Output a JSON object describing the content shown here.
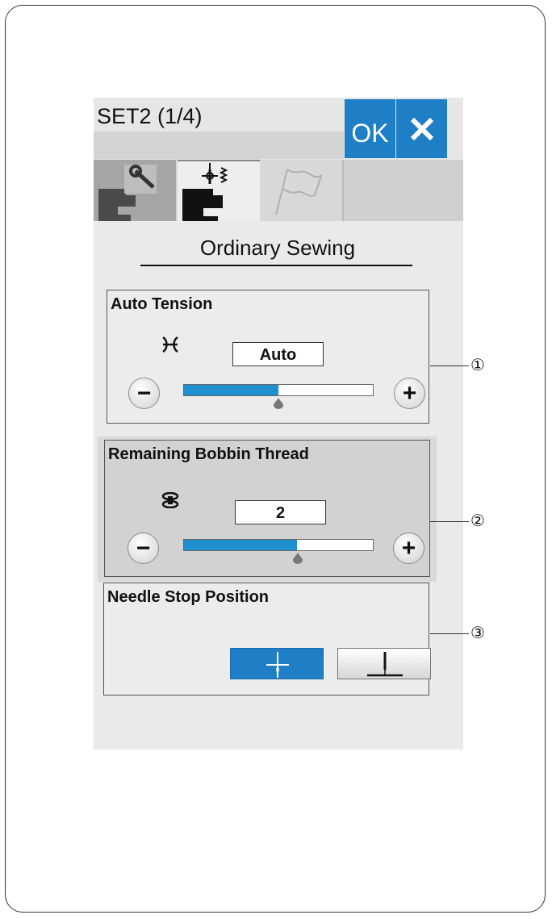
{
  "header": {
    "title": "SET2 (1/4)",
    "ok_label": "OK",
    "close_label": "✕"
  },
  "tabs": [
    {
      "name": "machine-settings",
      "icon": "wrench-machine-icon",
      "selected": false
    },
    {
      "name": "ordinary-sewing",
      "icon": "machine-stitch-icon",
      "selected": true
    },
    {
      "name": "language",
      "icon": "flag-icon",
      "selected": false
    }
  ],
  "section": {
    "title": "Ordinary Sewing"
  },
  "auto_tension": {
    "label": "Auto Tension",
    "icon": "tension-icon",
    "value": "Auto",
    "minus": "−",
    "plus": "+",
    "level_fraction": 0.5
  },
  "bobbin": {
    "label": "Remaining Bobbin Thread",
    "icon": "bobbin-icon",
    "value": "2",
    "minus": "−",
    "plus": "+",
    "level_fraction": 0.6
  },
  "needle_stop": {
    "label": "Needle Stop Position",
    "options": [
      "needle-up-icon",
      "needle-down-icon"
    ],
    "selected": "needle-up"
  },
  "callouts": [
    "①",
    "②",
    "③"
  ],
  "colors": {
    "accent": "#1f7fc6",
    "slider_fill": "#1f8fd0"
  }
}
